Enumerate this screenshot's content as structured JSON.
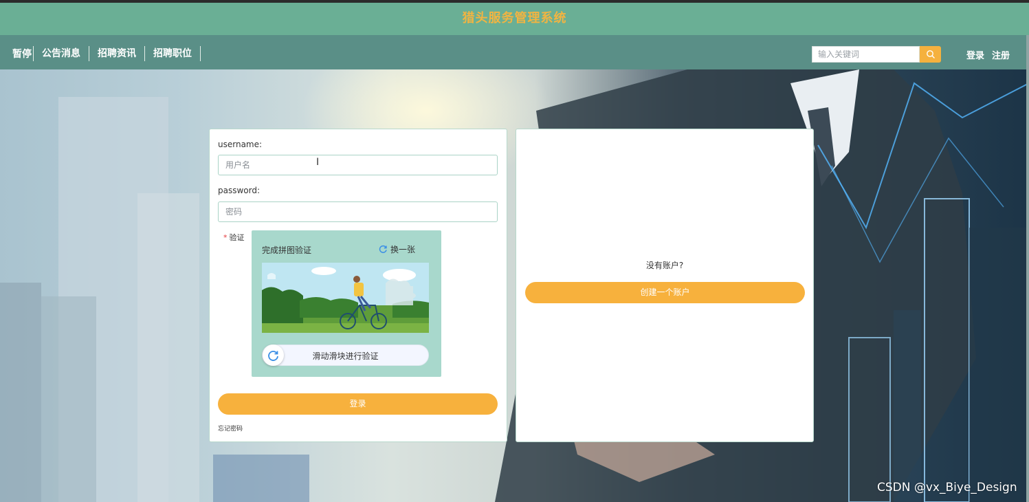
{
  "header": {
    "title": "猎头服务管理系统"
  },
  "nav": {
    "logo": "暂停",
    "items": [
      "公告消息",
      "招聘资讯",
      "招聘职位"
    ],
    "search_placeholder": "输入关键词",
    "login": "登录",
    "register": "注册"
  },
  "login_form": {
    "username_label": "username:",
    "username_placeholder": "用户名",
    "password_label": "password:",
    "password_placeholder": "密码",
    "verify_label": "验证",
    "captcha_title": "完成拼图验证",
    "captcha_refresh": "换一张",
    "slider_text": "滑动滑块进行验证",
    "login_button": "登录",
    "forgot": "忘记密码"
  },
  "register_panel": {
    "prompt": "没有账户?",
    "create_button": "创建一个账户"
  },
  "watermark": "CSDN @vx_Biye_Design",
  "colors": {
    "title_bar": "#6aaf95",
    "nav_bar": "#5a8f87",
    "accent": "#f7b13d",
    "title_text": "#f2b441"
  }
}
